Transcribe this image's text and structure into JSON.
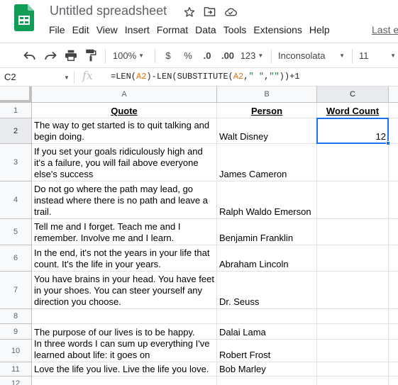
{
  "header": {
    "title": "Untitled spreadsheet",
    "menu": [
      "File",
      "Edit",
      "View",
      "Insert",
      "Format",
      "Data",
      "Tools",
      "Extensions",
      "Help"
    ],
    "last_edit": "Last e"
  },
  "toolbar": {
    "zoom": "100%",
    "currency": "$",
    "percent": "%",
    "decrease_decimal": ".0",
    "increase_decimal": ".00",
    "more_formats": "123",
    "font": "Inconsolata",
    "font_size": "11"
  },
  "formula_bar": {
    "cell_ref": "C2",
    "fx": "fx",
    "formula_parts": {
      "a": "=LEN(",
      "b": "A2",
      "c": ")-LEN(SUBSTITUTE(",
      "d": "A2",
      "e": ",",
      "f": "\" \"",
      "g": ",",
      "h": "\"\"",
      "i": "))+1"
    }
  },
  "grid": {
    "columns": [
      "A",
      "B",
      "C"
    ],
    "rows": [
      "1",
      "2",
      "3",
      "4",
      "5",
      "6",
      "7",
      "8",
      "9",
      "10",
      "11",
      "12"
    ],
    "header_row": {
      "quote": "Quote",
      "person": "Person",
      "count": "Word Count"
    },
    "data": [
      {
        "quote": "The way to get started is to quit talking and begin doing.",
        "person": "Walt Disney",
        "count": "12"
      },
      {
        "quote": "If you set your goals ridiculously high and it's a failure, you will fail above everyone else's success",
        "person": "James Cameron",
        "count": ""
      },
      {
        "quote": "Do not go where the path may lead, go instead where there is no path and leave a trail.",
        "person": "Ralph Waldo Emerson",
        "count": ""
      },
      {
        "quote": "Tell me and I forget. Teach me and I remember. Involve me and I learn.",
        "person": "Benjamin Franklin",
        "count": ""
      },
      {
        "quote": "In the end, it's not the years in your life that count. It's the life in your years.",
        "person": "Abraham Lincoln",
        "count": ""
      },
      {
        "quote": "You have brains in your head. You have feet in your shoes. You can steer yourself any direction you choose.",
        "person": "Dr. Seuss",
        "count": ""
      },
      {
        "quote": "",
        "person": "",
        "count": ""
      },
      {
        "quote": "The purpose of our lives is to be happy.",
        "person": "Dalai Lama",
        "count": ""
      },
      {
        "quote": "In three words I can sum up everything I've learned about life: it goes on",
        "person": "Robert Frost",
        "count": ""
      },
      {
        "quote": "Love the life you live. Live the life you love.",
        "person": "Bob Marley",
        "count": ""
      }
    ]
  },
  "icons": {
    "logo": "sheets-logo-icon",
    "star": "star-icon",
    "move": "move-to-folder-icon",
    "cloud": "cloud-saved-icon",
    "undo": "undo-icon",
    "redo": "redo-icon",
    "print": "print-icon",
    "paint_format": "paint-format-icon"
  },
  "colors": {
    "sheets_green": "#0f9d58",
    "selection_blue": "#1a73e8",
    "formula_ref": "#e8710a"
  }
}
